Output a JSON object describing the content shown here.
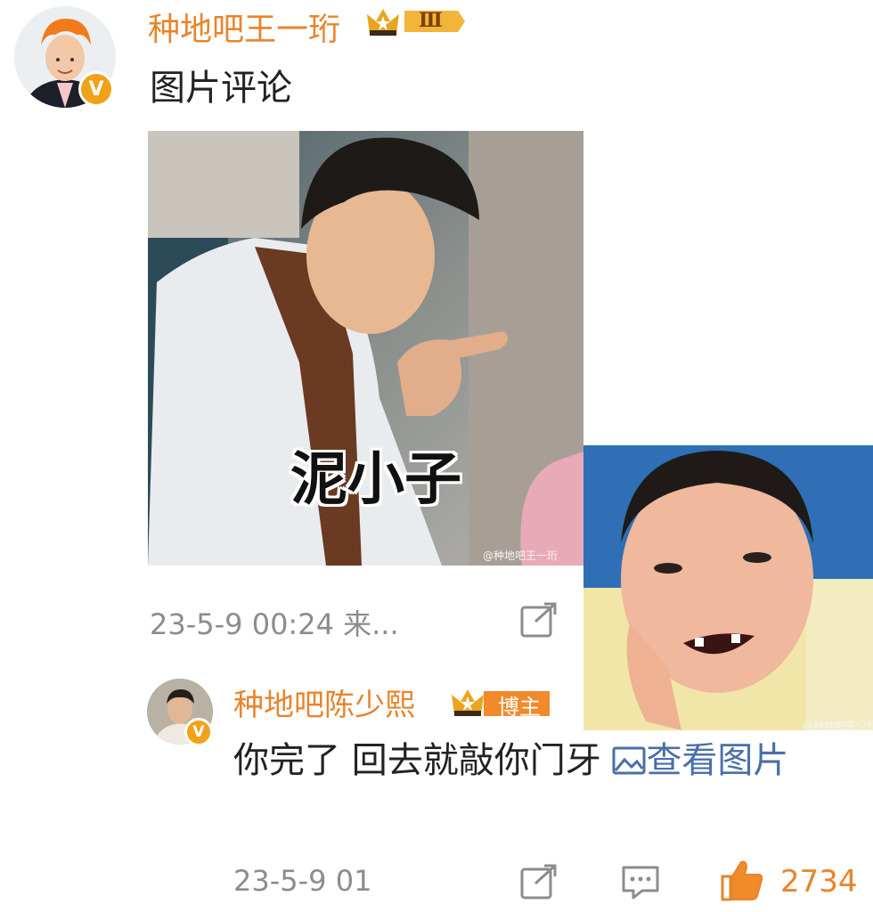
{
  "main_comment": {
    "username": "种地吧王一珩",
    "level_badge": "Ⅲ",
    "text": "图片评论",
    "meme_caption": "泥小子",
    "watermark": "@种地吧王一珩",
    "timestamp": "23-5-9 00:24 来..."
  },
  "reply": {
    "username": "种地吧陈少熙",
    "role_badge": "博主",
    "text": "你完了 回去就敲你门牙 ",
    "view_image_label": "查看图片",
    "watermark": "@种地吧陈少熙",
    "timestamp": "23-5-9 01",
    "like_count": "2734"
  },
  "colors": {
    "accent": "#e8842b",
    "link": "#4a6fa8",
    "meta": "#8c8c8c",
    "badge_gold": "#f0a21a"
  },
  "icons": [
    "verified-v-icon",
    "crown-icon",
    "share-icon",
    "comment-icon",
    "like-icon",
    "image-icon"
  ]
}
